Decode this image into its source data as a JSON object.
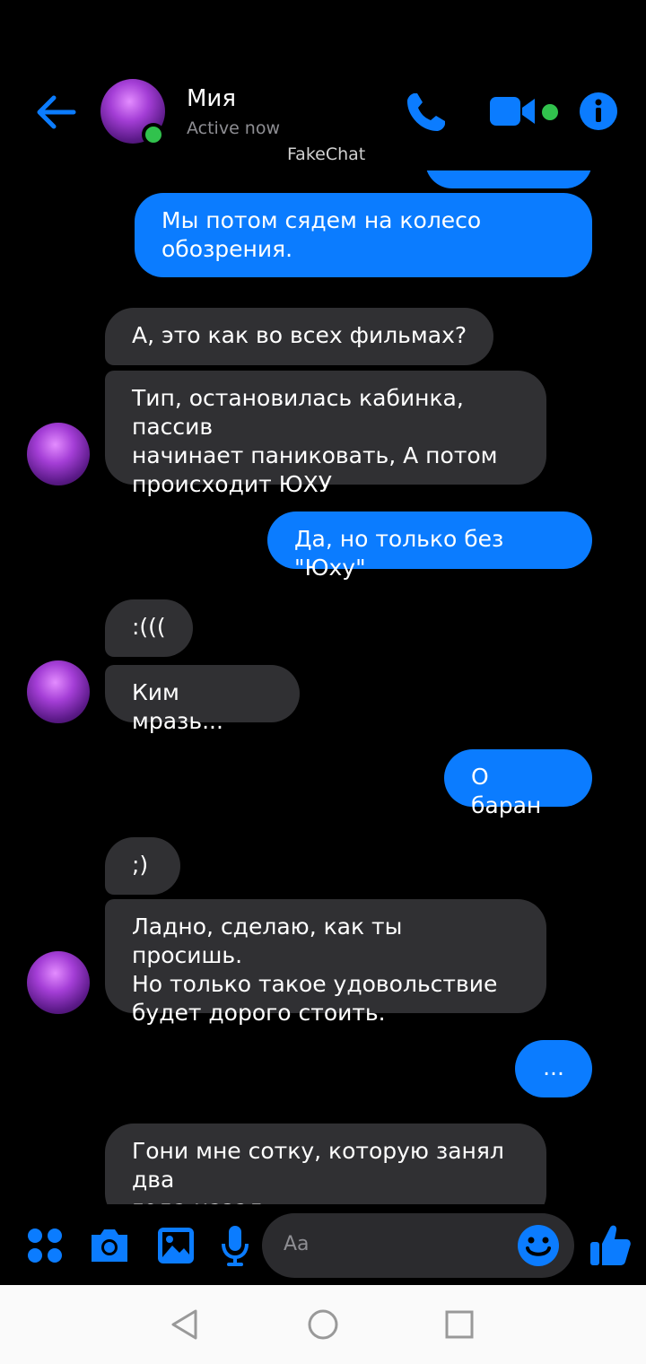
{
  "header": {
    "contact_name": "Мия",
    "status": "Active now",
    "app_label": "FakeChat"
  },
  "messages": [
    {
      "dir": "out",
      "text": "Мы потом сядем на колесо\nобозрения."
    },
    {
      "dir": "in",
      "text": "А, это как во всех фильмах?"
    },
    {
      "dir": "in",
      "text": "Тип, остановилась кабинка, пассив\nначинает паниковать, А потом\nпроисходит ЮХУ"
    },
    {
      "dir": "out",
      "text": "Да, но только без \"Юху\""
    },
    {
      "dir": "in",
      "text": ":((("
    },
    {
      "dir": "in",
      "text": "Ким мразь..."
    },
    {
      "dir": "out",
      "text": "О баран"
    },
    {
      "dir": "in",
      "text": ";)"
    },
    {
      "dir": "in",
      "text": "Ладно, сделаю, как ты просишь.\nНо только такое удовольствие\nбудет дорого стоить."
    },
    {
      "dir": "out",
      "text": "..."
    },
    {
      "dir": "in",
      "text": "Гони мне сотку, которую занял два\nгода назад."
    }
  ],
  "composer": {
    "placeholder": "Aa"
  },
  "colors": {
    "accent": "#0b7cff",
    "incoming_bubble": "#303033",
    "online": "#31c24d"
  }
}
